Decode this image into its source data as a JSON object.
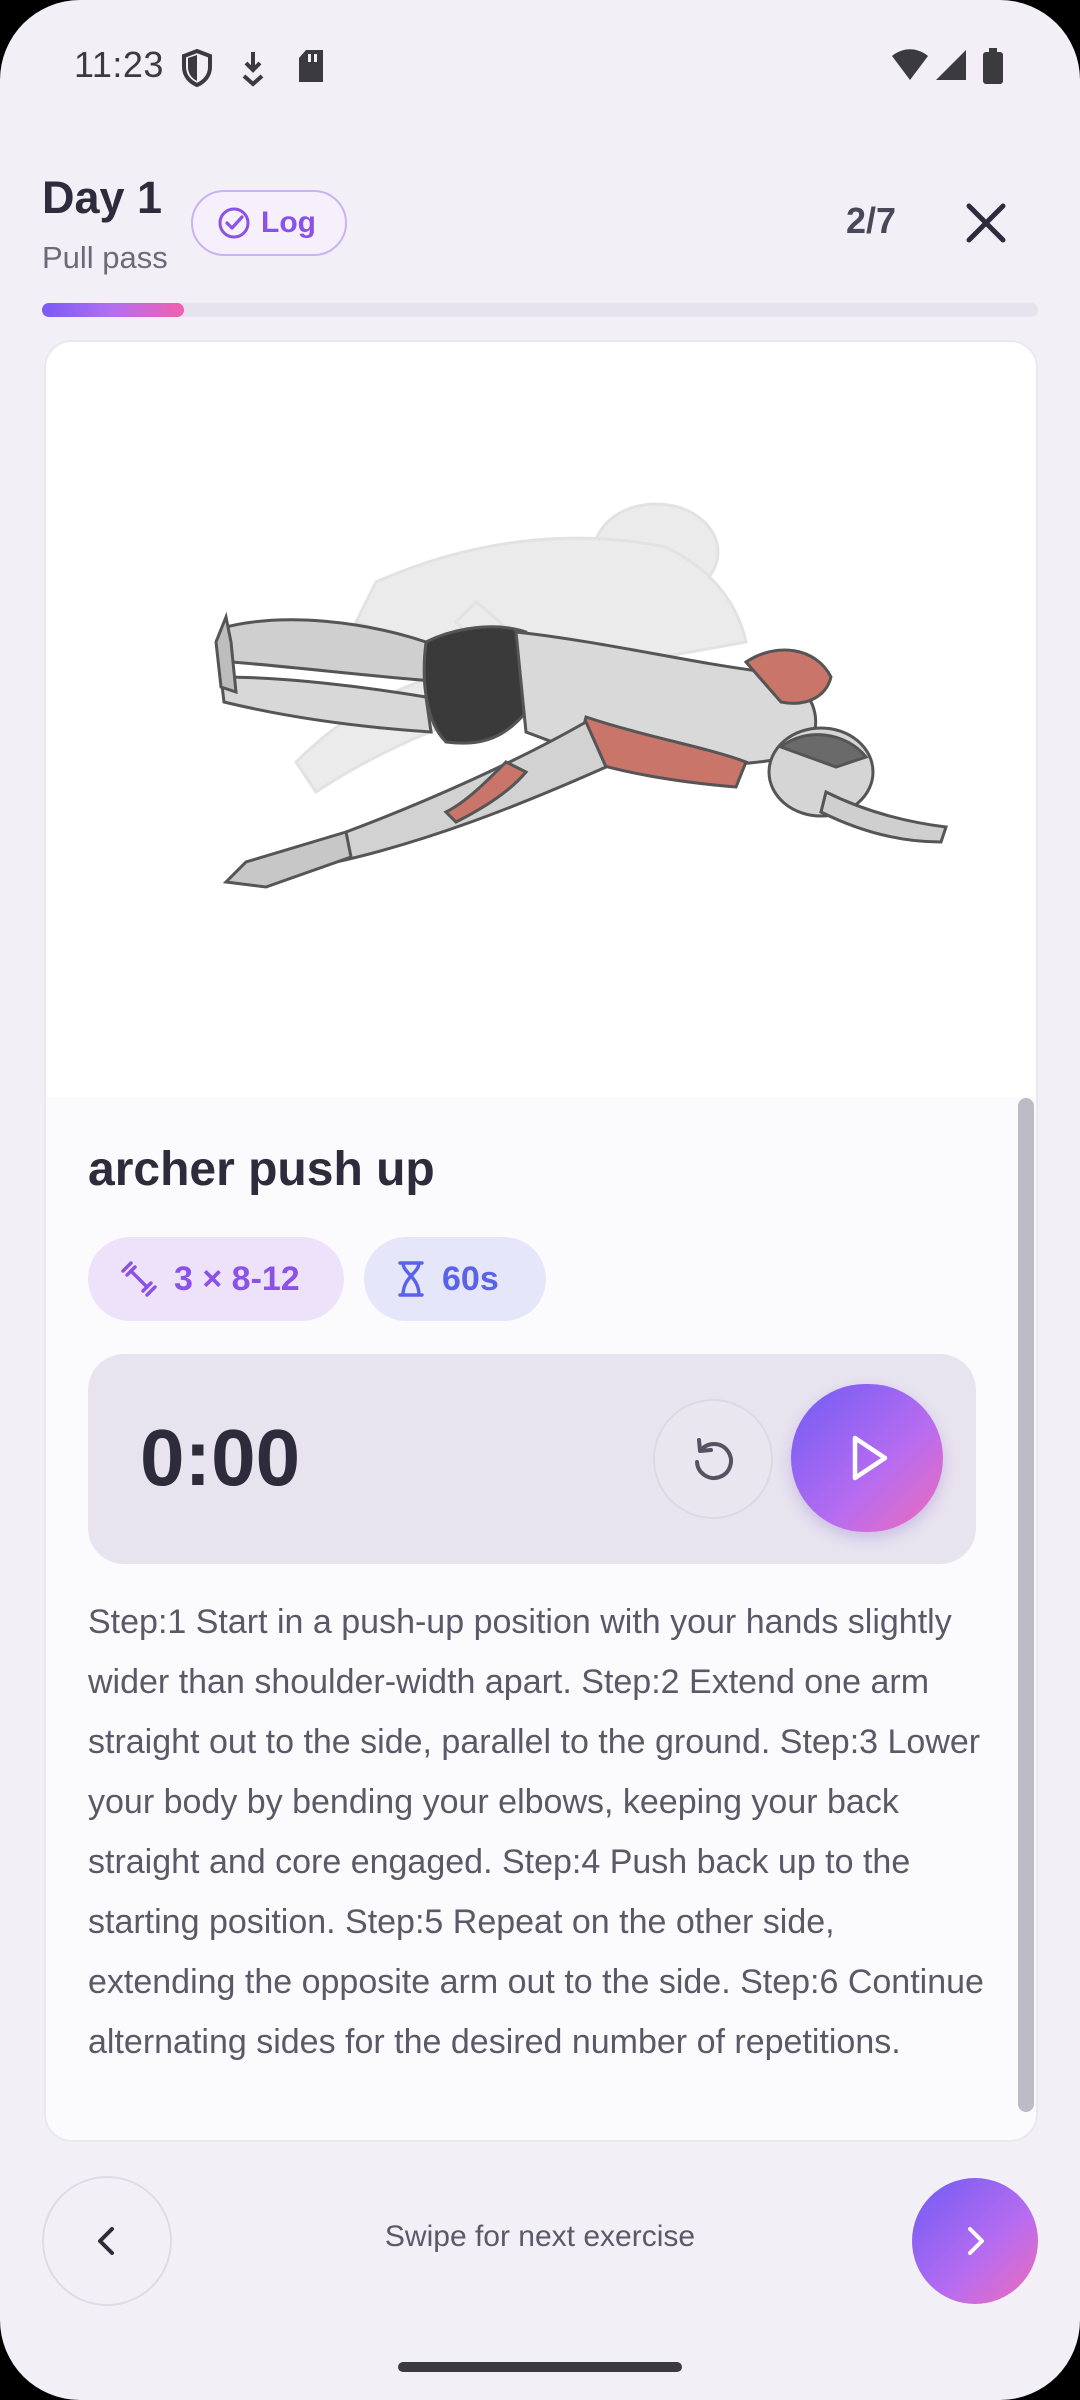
{
  "status_bar": {
    "time": "11:23",
    "icons": [
      "shield-icon",
      "download-icon",
      "sd-card-icon",
      "wifi-icon",
      "signal-icon",
      "battery-icon"
    ]
  },
  "header": {
    "day_title": "Day 1",
    "day_subtitle": "Pull pass",
    "log_label": "Log",
    "counter": "2/7",
    "progress_fraction": 0.143
  },
  "exercise": {
    "name": "archer push up",
    "image_icon": "exercise-illustration",
    "sets_label": "3 × 8-12",
    "rest_label": "60s",
    "timer": "0:00",
    "instructions": "Step:1 Start in a push-up position with your hands slightly wider than shoulder-width apart. Step:2 Extend one arm straight out to the side, parallel to the ground. Step:3 Lower your body by bending your elbows, keeping your back straight and core engaged. Step:4 Push back up to the starting position. Step:5 Repeat on the other side, extending the opposite arm out to the side. Step:6 Continue alternating sides for the desired number of repetitions."
  },
  "footer": {
    "swipe_hint": "Swipe for next exercise"
  },
  "colors": {
    "accent_purple": "#8a52e6",
    "accent_blue": "#5a63e8",
    "gradient_start": "#6f5cf5",
    "gradient_end": "#f06bb5",
    "background": "#f2f0f6"
  }
}
